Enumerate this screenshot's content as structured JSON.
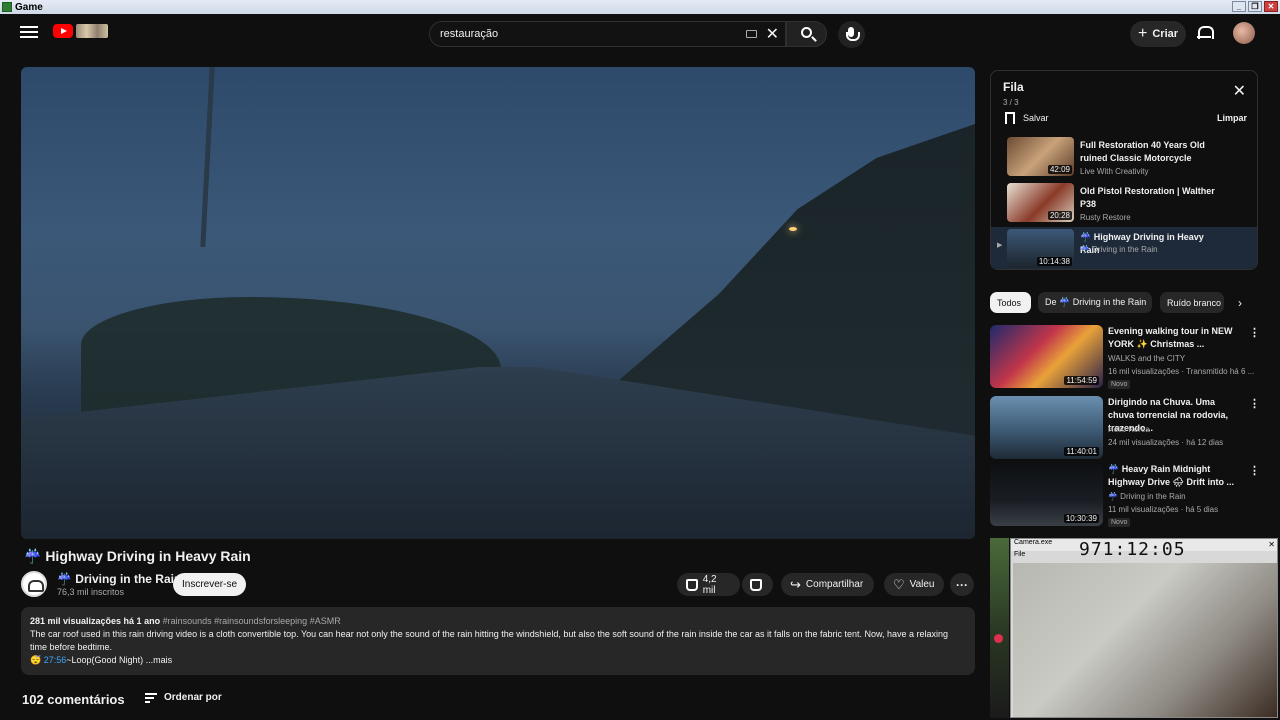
{
  "window": {
    "title": "Game",
    "buttons": [
      "_",
      "❐",
      "✕"
    ]
  },
  "header": {
    "search_value": "restauração",
    "create_label": "Criar"
  },
  "video": {
    "title": "☔ Highway Driving in Heavy Rain",
    "channel": "☔ Driving in the Rain",
    "subscribers": "76,3 mil inscritos",
    "subscribe_label": "Inscrever-se",
    "likes": "4,2 mil",
    "share_label": "Compartilhar",
    "thanks_label": "Valeu",
    "more_label": "···"
  },
  "description": {
    "stats": "281 mil visualizações  há 1 ano",
    "tags": "#rainsounds #rainsoundsforsleeping #ASMR",
    "text": "The car roof used in this rain driving video is a cloth convertible top. You can hear not only the sound of the rain hitting the windshield, but also the soft sound of the rain inside the car as it falls on the fabric tent. Now, have a relaxing time before bedtime.",
    "timestamp": "27:56",
    "chapter": "~Loop(Good Night)",
    "more": "...mais"
  },
  "comments": {
    "count_label": "102 comentários",
    "sort_label": "Ordenar por"
  },
  "queue": {
    "title": "Fila",
    "count": "3 / 3",
    "save_label": "Salvar",
    "clear_label": "Limpar",
    "items": [
      {
        "title": "Full Restoration 40 Years Old ruined Classic Motorcycle",
        "channel": "Live With Creativity",
        "duration": "42:09"
      },
      {
        "title": "Old Pistol Restoration | Walther P38",
        "channel": "Rusty Restore",
        "duration": "20:28"
      },
      {
        "title": "☔ Highway Driving in Heavy Rain",
        "channel": "☔ Driving in the Rain",
        "duration": "10:14:38",
        "playing_mark": "▶"
      }
    ]
  },
  "chips": [
    "Todos",
    "De ☔ Driving in the Rain",
    "Ruído branco"
  ],
  "recommendations": [
    {
      "title": "Evening walking tour in NEW YORK ✨ Christmas ...",
      "channel": "WALKS and the CITY",
      "meta": "16 mil visualizações · Transmitido há 6 ...",
      "duration": "11:54:59",
      "badge": "Novo"
    },
    {
      "title": "Dirigindo na Chuva. Uma chuva torrencial na rodovia, trazendo...",
      "channel": "Hello Korea",
      "meta": "24 mil visualizações · há 12 dias",
      "duration": "11:40:01",
      "badge": ""
    },
    {
      "title": "☔ Heavy Rain Midnight Highway Drive 🌧 Drift into ...",
      "channel": "☔ Driving in the Rain",
      "meta": "11 mil visualizações · há 5 dias",
      "duration": "10:30:39",
      "badge": "Novo"
    }
  ],
  "overlay": {
    "app_title": "Camera.exe",
    "timer": "971:12:05",
    "menu": "File"
  },
  "colors": {
    "accent": "#3ea6ff",
    "brand": "#ff0000",
    "background": "#0f0f0f"
  }
}
